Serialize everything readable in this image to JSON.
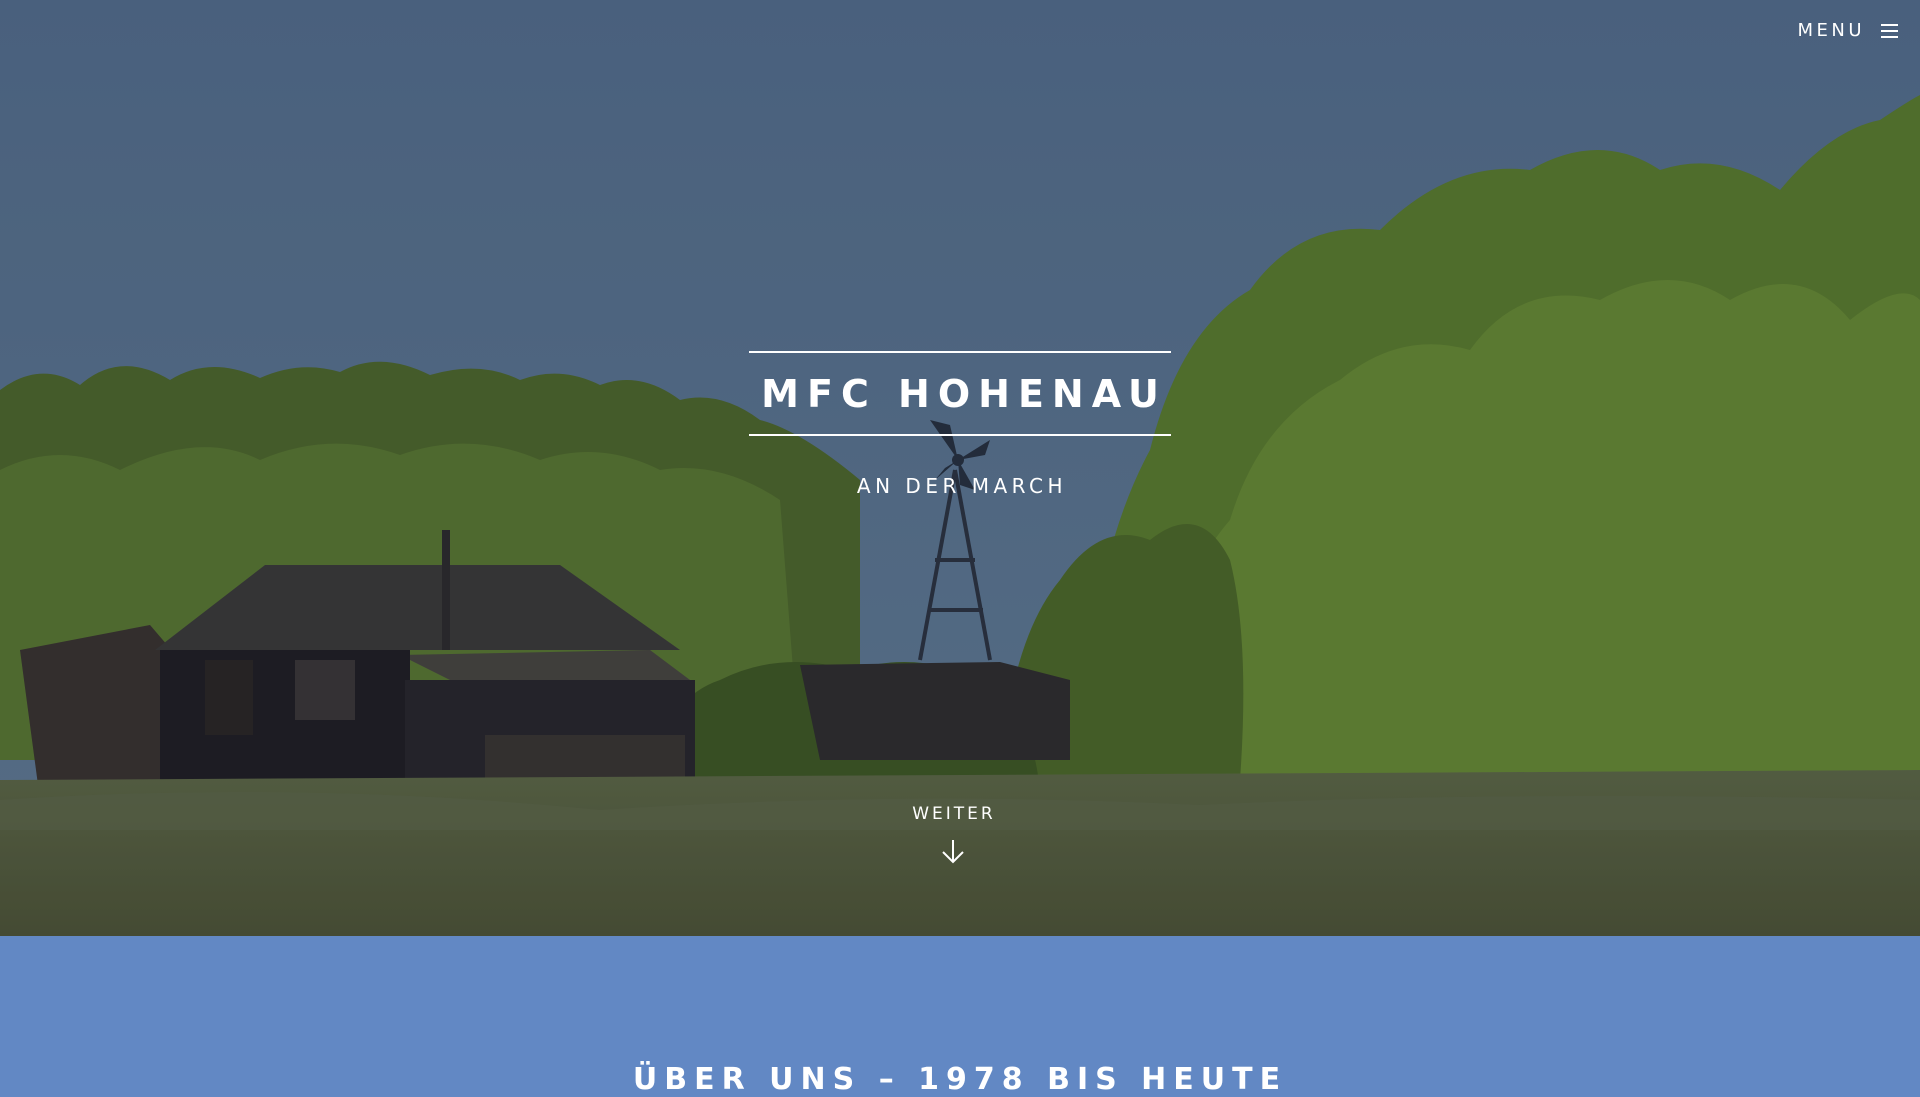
{
  "header": {
    "menu_label": "MENU",
    "menu_icon": "hamburger-icon"
  },
  "hero": {
    "title": "MFC HOHENAU",
    "subtitle": "AN DER MARCH",
    "scroll_label": "WEITER",
    "scroll_icon": "arrow-down-icon"
  },
  "about": {
    "heading": "ÜBER UNS – 1978 BIS HEUTE"
  },
  "colors": {
    "section_blue": "#6288c4",
    "text": "#ffffff"
  }
}
